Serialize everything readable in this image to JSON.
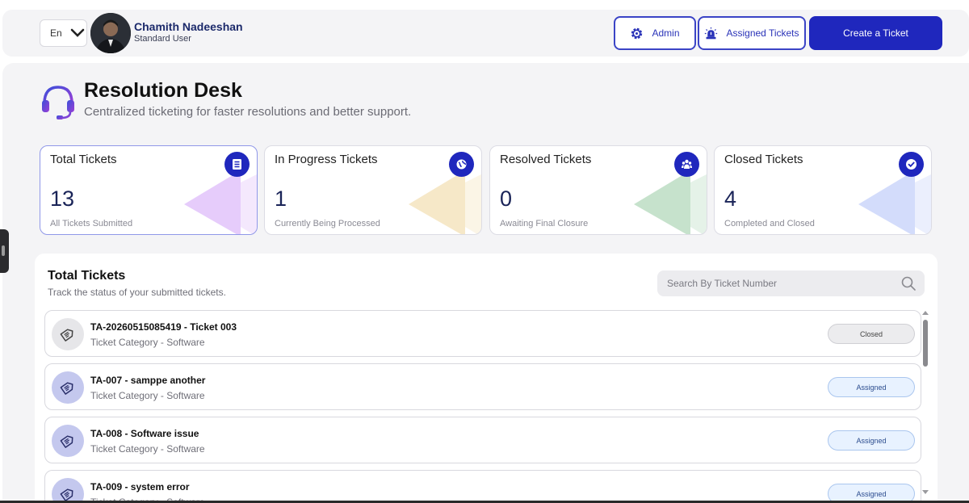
{
  "header": {
    "language": "En",
    "user_name": "Chamith Nadeeshan",
    "user_role": "Standard User",
    "admin_label": "Admin",
    "assigned_label": "Assigned Tickets",
    "create_label": "Create a Ticket"
  },
  "page": {
    "title": "Resolution Desk",
    "subtitle": "Centralized ticketing for faster resolutions and better support."
  },
  "stats": [
    {
      "title": "Total Tickets",
      "value": "13",
      "sub": "All Tickets Submitted",
      "icon": "document-list-icon",
      "deco_color": "#e6ccfb"
    },
    {
      "title": "In Progress Tickets",
      "value": "1",
      "sub": "Currently Being Processed",
      "icon": "globe-icon",
      "deco_color": "#f6e8c8"
    },
    {
      "title": "Resolved Tickets",
      "value": "0",
      "sub": "Awaiting Final Closure",
      "icon": "team-icon",
      "deco_color": "#c6e2cc"
    },
    {
      "title": "Closed Tickets",
      "value": "4",
      "sub": "Completed and Closed",
      "icon": "check-circle-icon",
      "deco_color": "#d3dcfb"
    }
  ],
  "tickets_panel": {
    "title": "Total Tickets",
    "subtitle": "Track the status of your submitted tickets.",
    "search_placeholder": "Search By Ticket Number"
  },
  "tickets": [
    {
      "title": "TA-20260515085419 - Ticket 003",
      "category": "Ticket Category - Software",
      "status": "Closed"
    },
    {
      "title": "TA-007 - samppe another",
      "category": "Ticket Category - Software",
      "status": "Assigned"
    },
    {
      "title": "TA-008 - Software issue",
      "category": "Ticket Category - Software",
      "status": "Assigned"
    },
    {
      "title": "TA-009 - system error",
      "category": "Ticket Category - Software",
      "status": "Assigned"
    }
  ],
  "colors": {
    "primary": "#1f27bd",
    "page_bg": "#f4f4f6"
  }
}
